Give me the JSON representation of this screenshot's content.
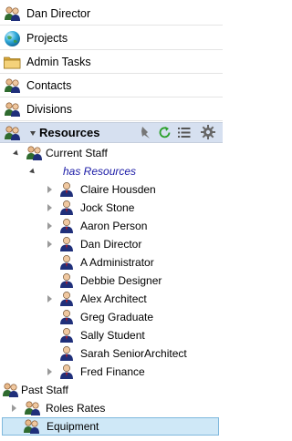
{
  "nav": [
    {
      "label": "Dan Director",
      "icon": "person-group-icon"
    },
    {
      "label": "Projects",
      "icon": "globe-icon"
    },
    {
      "label": "Admin Tasks",
      "icon": "folder-icon"
    },
    {
      "label": "Contacts",
      "icon": "person-group-icon"
    },
    {
      "label": "Divisions",
      "icon": "person-group-icon"
    }
  ],
  "resources": {
    "title": "Resources",
    "tools": [
      "pin-icon",
      "refresh-icon",
      "list-icon",
      "gear-icon"
    ]
  },
  "tree": {
    "current_staff": "Current Staff",
    "has_resources": "has Resources",
    "people": [
      "Claire Housden",
      "Jock Stone",
      "Aaron Person",
      "Dan Director",
      "A Administrator",
      "Debbie Designer",
      "Alex Architect",
      "Greg Graduate",
      "Sally Student",
      "Sarah SeniorArchitect",
      "Fred Finance"
    ],
    "past_staff": "Past Staff",
    "roles_rates": "Roles Rates",
    "equipment": "Equipment"
  },
  "colors": {
    "header_bg": "#d6e0f0",
    "has_resources": "#1a1aa6",
    "selected_bg": "#cfe8f7",
    "refresh": "#2aa02a"
  }
}
